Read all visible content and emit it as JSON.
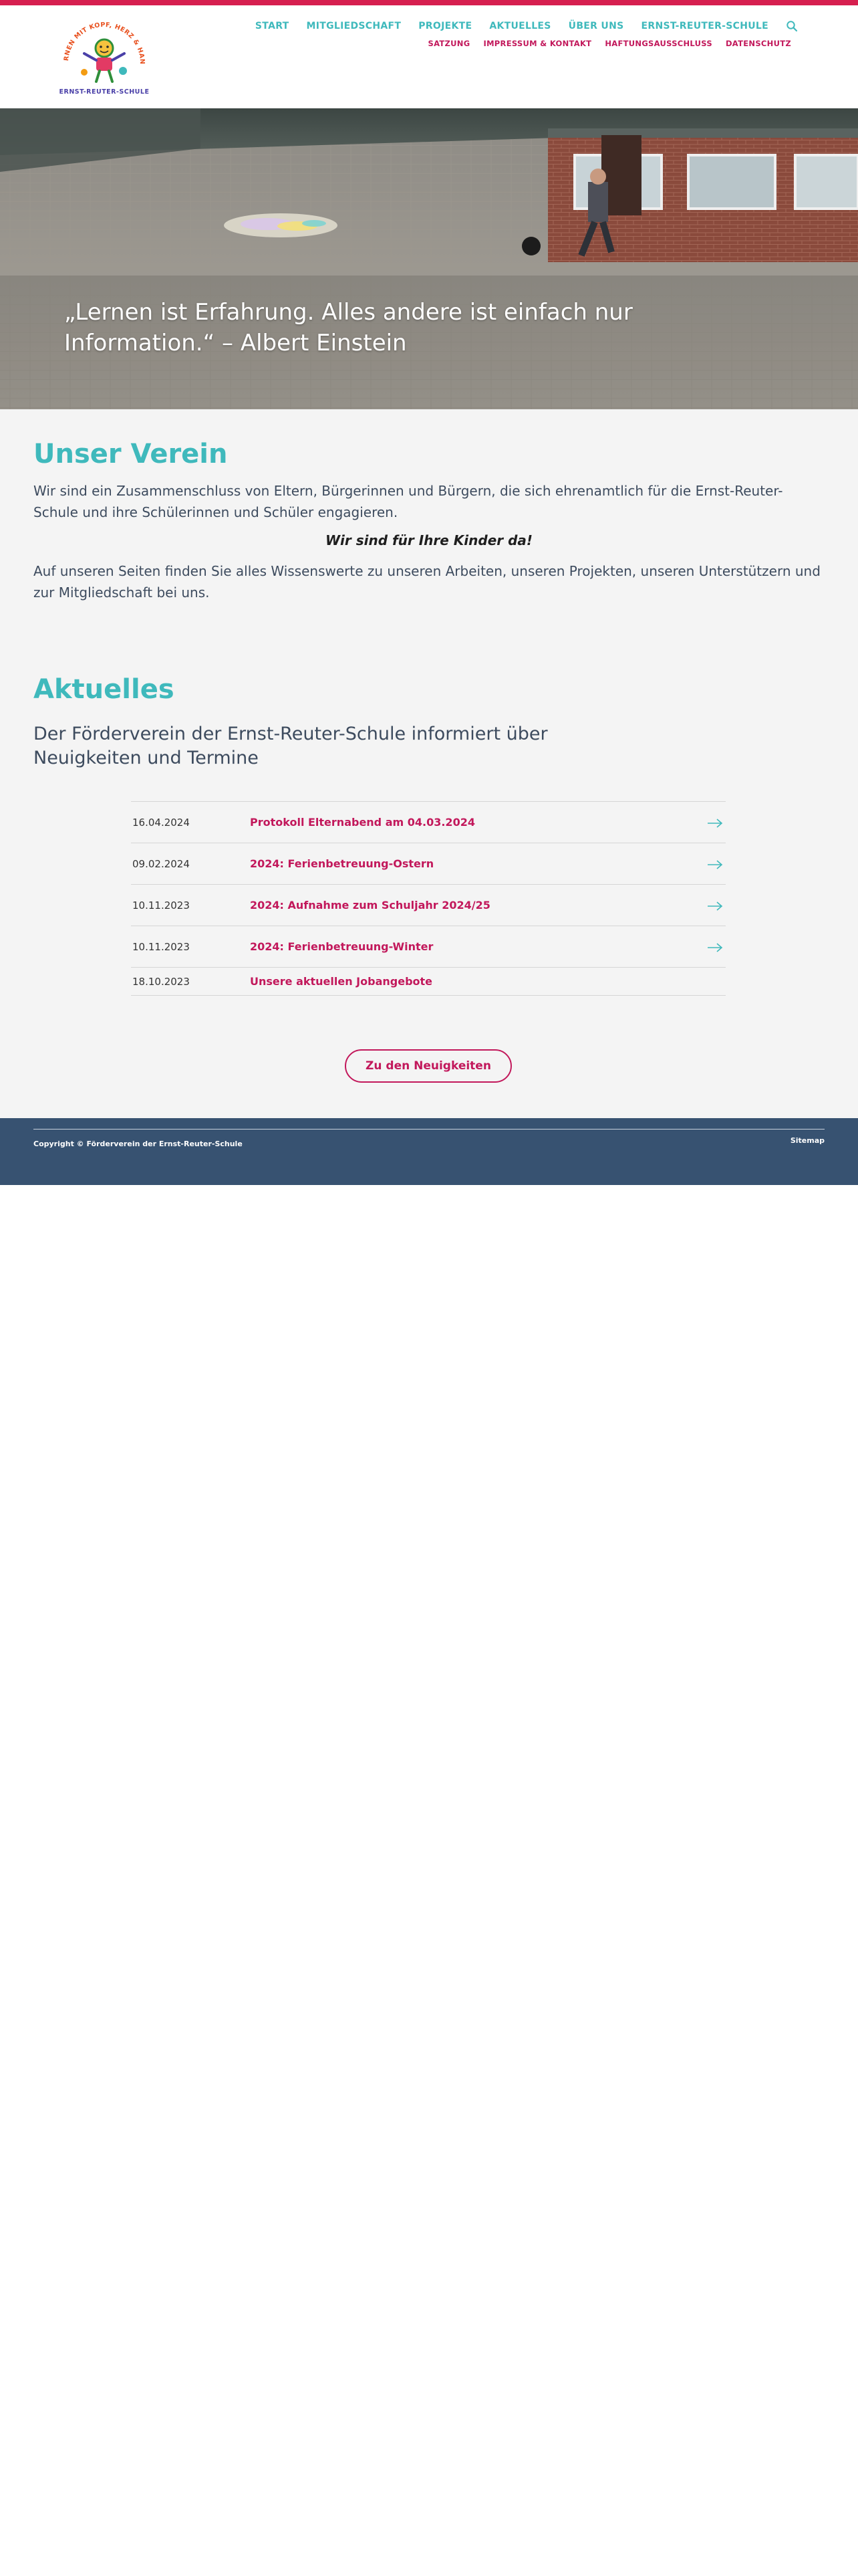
{
  "brand": {
    "logo_arc_text": "LERNEN MIT KOPF, HERZ & HAND",
    "logo_caption": "ERNST-REUTER-SCHULE"
  },
  "nav": {
    "items": [
      "START",
      "MITGLIEDSCHAFT",
      "PROJEKTE",
      "AKTUELLES",
      "ÜBER UNS",
      "ERNST-REUTER-SCHULE"
    ],
    "search_icon": "search-icon",
    "sub_items": [
      "SATZUNG",
      "IMPRESSUM & KONTAKT",
      "HAFTUNGSAUSSCHLUSS",
      "DATENSCHUTZ"
    ]
  },
  "hero": {
    "quote": "„Lernen ist Erfahrung. Alles andere ist einfach nur Information.“ – Albert Einstein"
  },
  "verein": {
    "title": "Unser Verein",
    "p1": "Wir sind ein Zusammenschluss von Eltern, Bürgerinnen und Bürgern, die sich ehrenamtlich für die Ernst-Reuter-Schule und ihre Schülerinnen und Schüler engagieren.",
    "p2": "Wir sind für Ihre Kinder da!",
    "p3": "Auf unseren Seiten finden Sie alles Wissenswerte zu unseren Arbeiten, unseren Projekten, unseren Unterstützern und zur Mitgliedschaft bei uns."
  },
  "aktuelles": {
    "title": "Aktuelles",
    "subtitle": "Der Förderverein der Ernst-Reuter-Schule informiert über Neuigkeiten und Termine",
    "news": [
      {
        "date": "16.04.2024",
        "title": "Protokoll Elternabend am 04.03.2024"
      },
      {
        "date": "09.02.2024",
        "title": "2024: Ferienbetreuung-Ostern"
      },
      {
        "date": "10.11.2023",
        "title": "2024: Aufnahme zum Schuljahr 2024/25"
      },
      {
        "date": "10.11.2023",
        "title": "2024: Ferienbetreuung-Winter"
      },
      {
        "date": "18.10.2023",
        "title": "Unsere aktuellen Jobangebote"
      }
    ],
    "button": "Zu den Neuigkeiten"
  },
  "footer": {
    "copyright": "Copyright © Förderverein der Ernst-Reuter-Schule",
    "sitemap": "Sitemap"
  },
  "colors": {
    "accent_teal": "#3fb9bc",
    "accent_magenta": "#c2185b",
    "top_bar": "#d61f4f",
    "footer_bg": "#375271"
  }
}
